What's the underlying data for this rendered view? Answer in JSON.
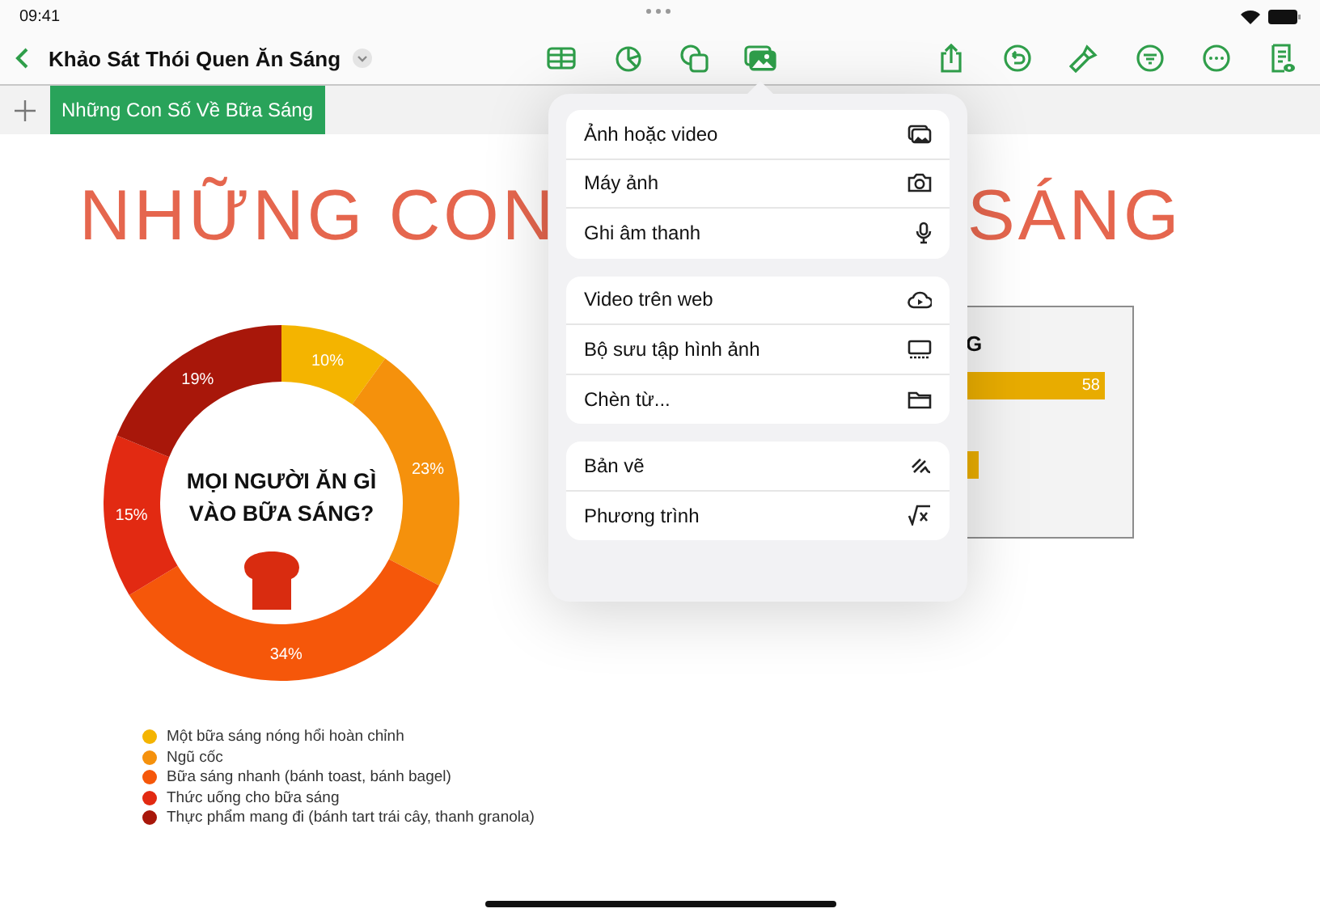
{
  "status_bar": {
    "time": "09:41"
  },
  "toolbar": {
    "title": "Khảo Sát Thói Quen Ăn Sáng",
    "center_tools": [
      {
        "kind": "table",
        "selected": false
      },
      {
        "kind": "chart",
        "selected": false
      },
      {
        "kind": "shape",
        "selected": false
      },
      {
        "kind": "media",
        "selected": true
      }
    ],
    "right_tools": [
      {
        "kind": "share"
      },
      {
        "kind": "undo"
      },
      {
        "kind": "brush"
      },
      {
        "kind": "filter"
      },
      {
        "kind": "more"
      },
      {
        "kind": "document"
      }
    ]
  },
  "sheet_tabs": [
    {
      "label": "Những Con Số Về Bữa Sáng",
      "selected": true
    }
  ],
  "canvas": {
    "title_parts": [
      "NHỮNG CON",
      "SÁNG"
    ],
    "donut": {
      "center_text": "MỌI NGƯỜI ĂN GÌ VÀO BỮA SÁNG?",
      "chart_data": {
        "type": "donut",
        "categories": [
          "Một bữa sáng nóng hổi hoàn chỉnh",
          "Ngũ cốc",
          "Bữa sáng nhanh (bánh toast, bánh bagel)",
          "Thức uống cho bữa sáng",
          "Thực phẩm mang đi (bánh tart trái cây, thanh granola)"
        ],
        "values": [
          10,
          23,
          34,
          15,
          19
        ],
        "colors": [
          "#f4b400",
          "#f5910c",
          "#f5570a",
          "#e22a12",
          "#a8170a"
        ],
        "value_labels": [
          "10%",
          "23%",
          "34%",
          "15%",
          "19%"
        ]
      }
    },
    "bar_card": {
      "heading": "G",
      "bar_labels": [
        "58"
      ]
    }
  },
  "insert_menu": {
    "groups": [
      {
        "items": [
          {
            "label": "Ảnh hoặc video",
            "kind": "photo"
          },
          {
            "label": "Máy ảnh",
            "kind": "camera"
          },
          {
            "label": "Ghi âm thanh",
            "kind": "mic"
          }
        ]
      },
      {
        "items": [
          {
            "label": "Video trên web",
            "kind": "cloud"
          },
          {
            "label": "Bộ sưu tập hình ảnh",
            "kind": "gallery"
          },
          {
            "label": "Chèn từ...",
            "kind": "folder"
          }
        ]
      },
      {
        "items": [
          {
            "label": "Bản vẽ",
            "kind": "drawing"
          },
          {
            "label": "Phương trình",
            "kind": "equation"
          }
        ]
      }
    ]
  }
}
